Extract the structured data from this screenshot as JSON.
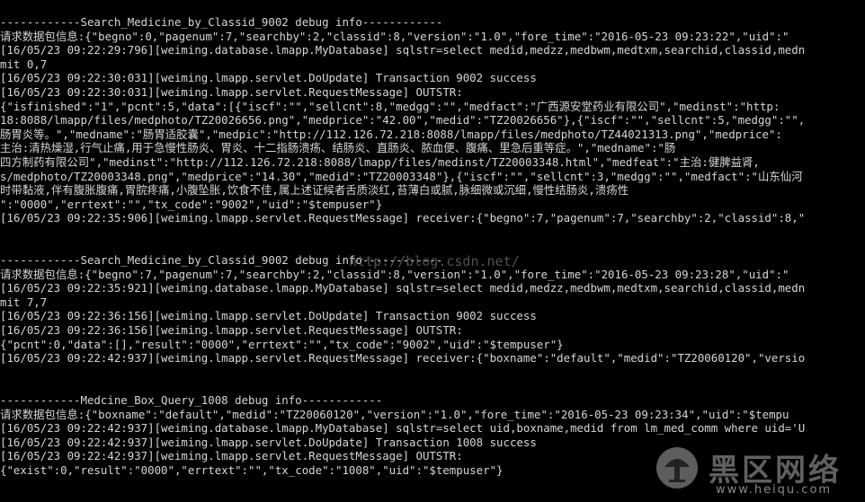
{
  "console": {
    "lines": [
      "------------Search_Medicine_by_Classid_9002 debug info------------",
      "请求数据包信息:{\"begno\":0,\"pagenum\":7,\"searchby\":2,\"classid\":8,\"version\":\"1.0\",\"fore_time\":\"2016-05-23 09:23:22\",\"uid\":\"",
      "[16/05/23 09:22:29:796][weiming.database.lmapp.MyDatabase] sqlstr=select medid,medzz,medbwm,medtxm,searchid,classid,medn",
      "mit 0,7",
      "[16/05/23 09:22:30:031][weiming.lmapp.servlet.DoUpdate] Transaction 9002 success",
      "[16/05/23 09:22:30:031][weiming.lmapp.servlet.RequestMessage] OUTSTR:",
      "{\"isfinished\":\"1\",\"pcnt\":5,\"data\":[{\"iscf\":\"\",\"sellcnt\":8,\"medgg\":\"\",\"medfact\":\"广西源安堂药业有限公司\",\"medinst\":\"http:",
      "18:8088/lmapp/files/medphoto/TZ20026656.png\",\"medprice\":\"42.00\",\"medid\":\"TZ20026656\"},{\"iscf\":\"\",\"sellcnt\":5,\"medgg\":\"\",",
      "肠胃炎等。\",\"medname\":\"肠胃适胶囊\",\"medpic\":\"http://112.126.72.218:8088/lmapp/files/medphoto/TZ44021313.png\",\"medprice\":",
      "主治:清热燥湿,行气止痛,用于急慢性肠炎、胃炎、十二指肠溃疡、结肠炎、直肠炎、脓血便、腹痛、里急后重等症。\",\"medname\":\"肠",
      "四方制药有限公司\",\"medinst\":\"http://112.126.72.218:8088/lmapp/files/medinst/TZ20003348.html\",\"medfeat\":\"主治:健脾益肾,",
      "s/medphoto/TZ20003348.png\",\"medprice\":\"14.30\",\"medid\":\"TZ20003348\"},{\"iscf\":\"\",\"sellcnt\":3,\"medgg\":\"\",\"medfact\":\"山东仙河",
      "时带黏液,伴有腹胀腹痛,胃脘疼痛,小腹坠胀,饮食不佳,属上述证候者舌质淡红,苔薄白或腻,脉细微或沉细,慢性结肠炎,溃疡性",
      "\":\"0000\",\"errtext\":\"\",\"tx_code\":\"9002\",\"uid\":\"$tempuser\"}",
      "[16/05/23 09:22:35:906][weiming.lmapp.servlet.RequestMessage] receiver:{\"begno\":7,\"pagenum\":7,\"searchby\":2,\"classid\":8,\"",
      "",
      "",
      "------------Search_Medicine_by_Classid_9002 debug info------------",
      "请求数据包信息:{\"begno\":7,\"pagenum\":7,\"searchby\":2,\"classid\":8,\"version\":\"1.0\",\"fore_time\":\"2016-05-23 09:23:28\",\"uid\":\"",
      "[16/05/23 09:22:35:921][weiming.database.lmapp.MyDatabase] sqlstr=select medid,medzz,medbwm,medtxm,searchid,classid,medn",
      "mit 7,7",
      "[16/05/23 09:22:36:156][weiming.lmapp.servlet.DoUpdate] Transaction 9002 success",
      "[16/05/23 09:22:36:156][weiming.lmapp.servlet.RequestMessage] OUTSTR:",
      "{\"pcnt\":0,\"data\":[],\"result\":\"0000\",\"errtext\":\"\",\"tx_code\":\"9002\",\"uid\":\"$tempuser\"}",
      "[16/05/23 09:22:42:937][weiming.lmapp.servlet.RequestMessage] receiver:{\"boxname\":\"default\",\"medid\":\"TZ20060120\",\"versio",
      "",
      "",
      "------------Medcine_Box_Query_1008 debug info------------",
      "请求数据包信息:{\"boxname\":\"default\",\"medid\":\"TZ20060120\",\"version\":\"1.0\",\"fore_time\":\"2016-05-23 09:23:34\",\"uid\":\"$tempu",
      "[16/05/23 09:22:42:937][weiming.database.lmapp.MyDatabase] sqlstr=select uid,boxname,medid from lm_med_comm where uid='U",
      "[16/05/23 09:22:42:937][weiming.lmapp.servlet.DoUpdate] Transaction 1008 success",
      "[16/05/23 09:22:42:937][weiming.lmapp.servlet.RequestMessage] OUTSTR:",
      "{\"exist\":0,\"result\":\"0000\",\"errtext\":\"\",\"tx_code\":\"1008\",\"uid\":\"$tempuser\"}"
    ]
  },
  "watermark": {
    "url": "http://blog.csdn.net/",
    "brand": "黑区网络",
    "domain": "www.heiqu.com"
  },
  "colors": {
    "background": "#000000",
    "text": "#d6d6d6",
    "watermark": "#6b6b6b"
  }
}
